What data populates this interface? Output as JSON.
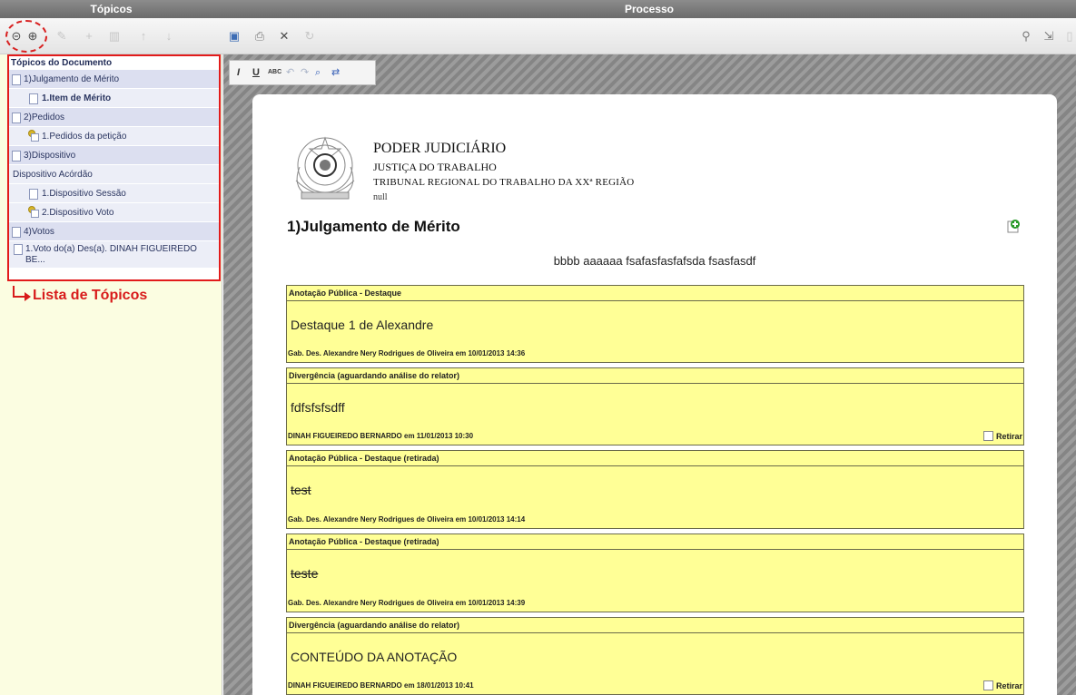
{
  "header": {
    "left_title": "Tópicos",
    "right_title": "Processo"
  },
  "toolbar": {
    "left_icons": [
      "collapse-all-icon",
      "expand-all-icon",
      "add-note-icon",
      "add-icon",
      "delete-icon",
      "move-up-icon",
      "move-down-icon"
    ],
    "right_icons": [
      "save-icon",
      "print-icon",
      "fullscreen-icon",
      "refresh-icon",
      "search-icon",
      "export-icon"
    ]
  },
  "sidebar": {
    "heading": "Tópicos do Documento",
    "items": [
      {
        "label": "1)Julgamento de Mérito",
        "level": 0,
        "icon": "doc"
      },
      {
        "label": "1.Item de Mérito",
        "level": 1,
        "icon": "doc",
        "selected": true
      },
      {
        "label": "2)Pedidos",
        "level": 0,
        "icon": "doc"
      },
      {
        "label": "1.Pedidos da petição",
        "level": 1,
        "icon": "note"
      },
      {
        "label": "3)Dispositivo",
        "level": 0,
        "icon": "doc"
      },
      {
        "label": "Dispositivo Acórdão",
        "level": 0,
        "icon": "none"
      },
      {
        "label": "1.Dispositivo Sessão",
        "level": 1,
        "icon": "doc"
      },
      {
        "label": "2.Dispositivo Voto",
        "level": 1,
        "icon": "note"
      },
      {
        "label": "4)Votos",
        "level": 0,
        "icon": "doc"
      },
      {
        "label": "1.Voto do(a) Des(a). DINAH FIGUEIREDO BE...",
        "level": 1,
        "icon": "doc"
      }
    ]
  },
  "annotation": {
    "label": "Lista de Tópicos",
    "color": "#d81b1b"
  },
  "editor": {
    "format_icons": [
      "italic-icon",
      "underline-icon",
      "spellcheck-icon",
      "undo-icon",
      "redo-icon",
      "find-icon",
      "replace-icon"
    ]
  },
  "document": {
    "court_name": "PODER JUDICIÁRIO",
    "court_sub": "JUSTIÇA DO TRABALHO",
    "court_region": "TRIBUNAL REGIONAL DO TRABALHO DA XXª REGIÃO",
    "court_null": "null",
    "section_title": "1)Julgamento de Mérito",
    "content": "bbbb aaaaaa fsafasfasfafsda fsasfasdf"
  },
  "notes": [
    {
      "header": "Anotação Pública - Destaque",
      "body": "Destaque 1 de Alexandre",
      "footer": "Gab. Des. Alexandre Nery Rodrigues de Oliveira em 10/01/2013 14:36",
      "struck": false,
      "retirar": null
    },
    {
      "header": "Divergência (aguardando análise do relator)",
      "body": "fdfsfsfsdff",
      "footer": "DINAH FIGUEIREDO BERNARDO em 11/01/2013 10:30",
      "struck": false,
      "retirar": "Retirar"
    },
    {
      "header": "Anotação Pública - Destaque (retirada)",
      "body": "test",
      "footer": "Gab. Des. Alexandre Nery Rodrigues de Oliveira em 10/01/2013 14:14",
      "struck": true,
      "retirar": null
    },
    {
      "header": "Anotação Pública - Destaque (retirada)",
      "body": "teste",
      "footer": "Gab. Des. Alexandre Nery Rodrigues de Oliveira em 10/01/2013 14:39",
      "struck": true,
      "retirar": null
    },
    {
      "header": "Divergência (aguardando análise do relator)",
      "body": "CONTEÚDO DA ANOTAÇÃO",
      "footer": "DINAH FIGUEIREDO BERNARDO em 18/01/2013 10:41",
      "struck": false,
      "retirar": "Retirar"
    }
  ]
}
